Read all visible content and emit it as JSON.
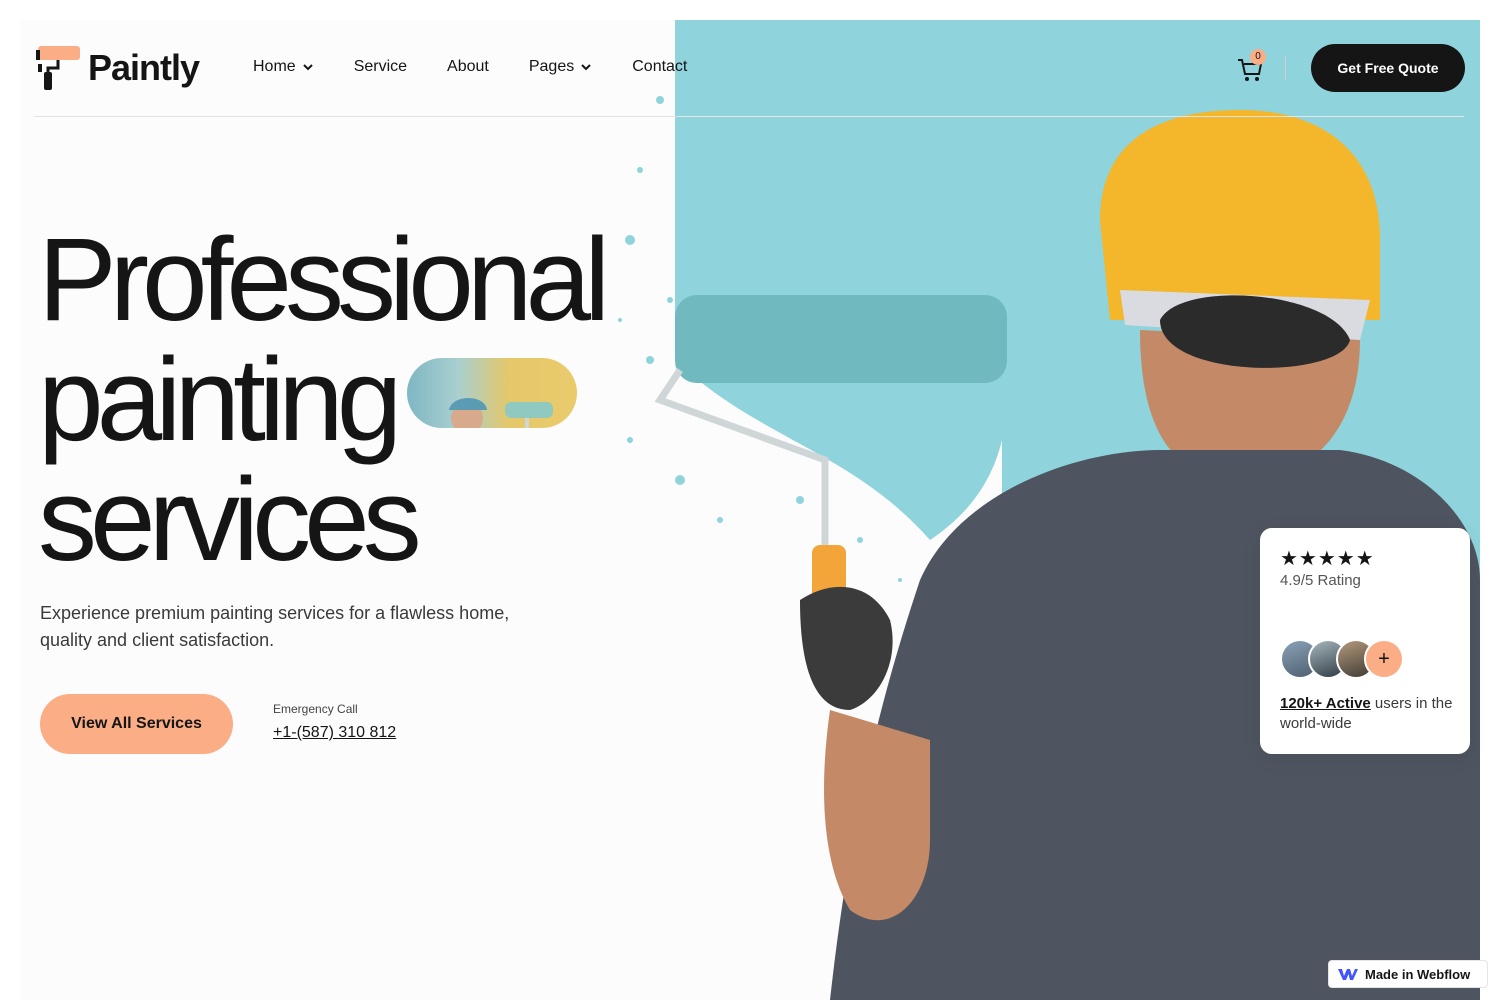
{
  "brand": {
    "name": "Paintly",
    "accent": "#fbad86",
    "wall_color": "#8fd4dc",
    "dark": "#151515"
  },
  "nav": {
    "items": [
      {
        "label": "Home",
        "dropdown": true
      },
      {
        "label": "Service",
        "dropdown": false
      },
      {
        "label": "About",
        "dropdown": false
      },
      {
        "label": "Pages",
        "dropdown": true
      },
      {
        "label": "Contact",
        "dropdown": false
      }
    ]
  },
  "header": {
    "cart_count": "0",
    "cta_label": "Get Free Quote"
  },
  "hero": {
    "title_line1": "Professional",
    "title_line2": "painting",
    "title_line3": "services",
    "subtitle": "Experience premium painting services for a flawless home, quality and client satisfaction.",
    "cta_label": "View All Services",
    "emergency_label": "Emergency Call",
    "emergency_phone": "+1-(587) 310 812"
  },
  "rating_card": {
    "stars": "★★★★★",
    "rating_text": "4.9/5 Rating",
    "active_link": "120k+ Active",
    "active_suffix": " users in the world-wide",
    "plus": "+"
  },
  "badge": {
    "label": "Made in Webflow"
  }
}
